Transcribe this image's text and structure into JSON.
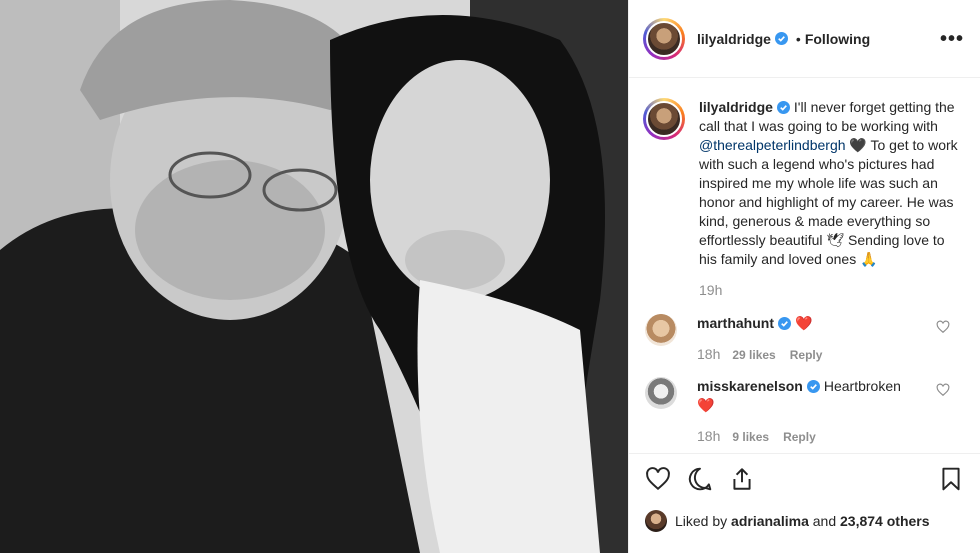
{
  "post": {
    "username": "lilyaldridge",
    "follow_status": "Following",
    "more": "•••",
    "dot": "•",
    "caption": {
      "username": "lilyaldridge",
      "text_1": "I'll never forget getting the call that I was going to be working with ",
      "mention": "@therealpeterlindbergh",
      "emoji_1": "🖤",
      "text_2": " To get to work with such a legend who's pictures had inspired me my whole life was such an honor and highlight of my career. He was kind, generous & made everything so effortlessly beautiful ",
      "emoji_2": "🕊",
      "text_3": " Sending love to his family and loved ones ",
      "emoji_3": "🙏",
      "time": "19h"
    },
    "comments": [
      {
        "username": "marthahunt",
        "text": "",
        "emoji": "❤️",
        "time": "18h",
        "likes": "29 likes",
        "reply": "Reply"
      },
      {
        "username": "misskarenelson",
        "text": "Heartbroken",
        "emoji": "❤️",
        "time": "18h",
        "likes": "9 likes",
        "reply": "Reply"
      }
    ],
    "liked_by": {
      "prefix": "Liked by ",
      "user": "adrianalima",
      "middle": " and ",
      "count": "23,874 others"
    }
  },
  "icons": {
    "verified": "verified-badge-icon",
    "like": "heart-icon",
    "comment": "comment-bubble-icon",
    "share": "share-icon",
    "save": "bookmark-icon"
  },
  "colors": {
    "verified": "#3897f0",
    "link": "#003569",
    "muted": "#8e8e8e",
    "heart": "#ed4956"
  }
}
